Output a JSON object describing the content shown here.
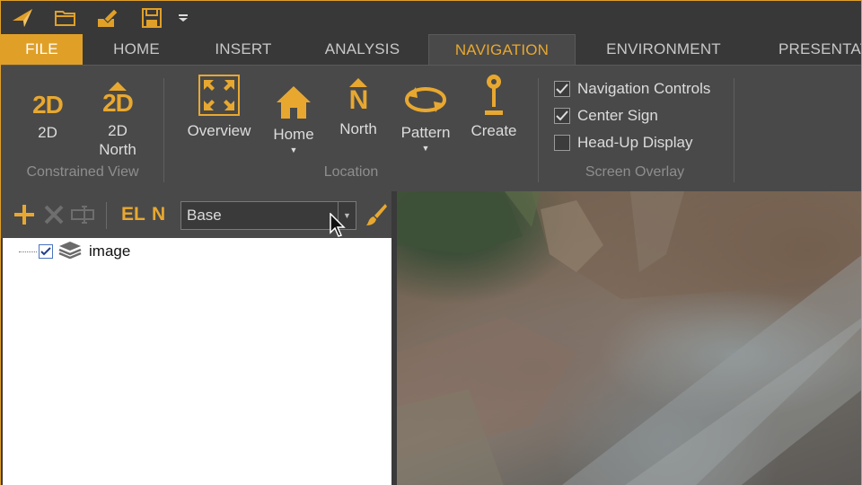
{
  "quick_access": {
    "icons": [
      "app-logo-icon",
      "open-folder-icon",
      "edit-project-icon",
      "save-icon",
      "customize-dropdown-icon"
    ]
  },
  "tabs": [
    {
      "label": "FILE"
    },
    {
      "label": "HOME"
    },
    {
      "label": "INSERT"
    },
    {
      "label": "ANALYSIS"
    },
    {
      "label": "NAVIGATION"
    },
    {
      "label": "ENVIRONMENT"
    },
    {
      "label": "PRESENTATI"
    }
  ],
  "active_tab": "NAVIGATION",
  "ribbon": {
    "constrained_view": {
      "group_label": "Constrained View",
      "btn_2d": {
        "icon_text": "2D",
        "label": "2D"
      },
      "btn_2d_north": {
        "icon_text": "2D",
        "label_line1": "2D",
        "label_line2": "North"
      }
    },
    "location": {
      "group_label": "Location",
      "overview": "Overview",
      "home": "Home",
      "north": "North",
      "north_icon_text": "N",
      "pattern": "Pattern",
      "create": "Create"
    },
    "screen_overlay": {
      "group_label": "Screen Overlay",
      "items": [
        {
          "label": "Navigation Controls",
          "checked": true
        },
        {
          "label": "Center Sign",
          "checked": true
        },
        {
          "label": "Head-Up Display",
          "checked": false
        }
      ]
    }
  },
  "layer_toolbar": {
    "el_label": "EL",
    "n_label": "N",
    "layer_select_value": "Base"
  },
  "tree": {
    "items": [
      {
        "label": "image",
        "checked": true
      }
    ]
  },
  "colors": {
    "accent": "#e0a028",
    "ribbon_bg": "#494949",
    "tab_bar_bg": "#383838",
    "text": "#dcdcdc",
    "group_label": "#8e8e8e"
  }
}
